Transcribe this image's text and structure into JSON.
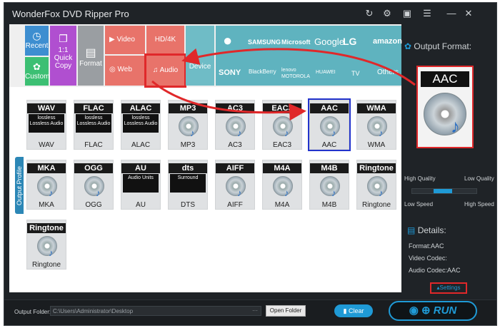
{
  "app": {
    "title": "WonderFox DVD Ripper Pro"
  },
  "titlebar_icons": [
    "refresh-icon",
    "settings-icon",
    "feedback-icon",
    "menu-icon",
    "minimize-icon",
    "close-icon"
  ],
  "categories": {
    "recent": "Recent",
    "custom": "Custom",
    "copy": "1:1 Quick Copy",
    "format": "Format",
    "video": "Video",
    "web": "Web",
    "hd": "HD/4K",
    "audio": "Audio",
    "device": "Device",
    "brands_top": [
      "",
      "SAMSUNG",
      "Microsoft",
      "Google",
      "LG",
      "amazon"
    ],
    "brands_bottom": [
      "SONY",
      "BlackBerry",
      "lenovo MOTOROLA",
      "HUAWEI",
      "TV",
      "Others"
    ],
    "output_profile": "Output Profile"
  },
  "formats": [
    {
      "code": "WAV",
      "name": "WAV",
      "sub": "lossless Lossless Audio"
    },
    {
      "code": "FLAC",
      "name": "FLAC",
      "sub": "lossless Lossless Audio"
    },
    {
      "code": "ALAC",
      "name": "ALAC",
      "sub": "lossless Lossless Audio"
    },
    {
      "code": "MP3",
      "name": "MP3",
      "sub": ""
    },
    {
      "code": "AC3",
      "name": "AC3",
      "sub": ""
    },
    {
      "code": "EAC3",
      "name": "EAC3",
      "sub": ""
    },
    {
      "code": "AAC",
      "name": "AAC",
      "sub": ""
    },
    {
      "code": "WMA",
      "name": "WMA",
      "sub": ""
    },
    {
      "code": "MKA",
      "name": "MKA",
      "sub": ""
    },
    {
      "code": "OGG",
      "name": "OGG",
      "sub": ""
    },
    {
      "code": "AU",
      "name": "AU",
      "sub": "Audio Units"
    },
    {
      "code": "dts",
      "name": "DTS",
      "sub": "Surround"
    },
    {
      "code": "AIFF",
      "name": "AIFF",
      "sub": ""
    },
    {
      "code": "M4A",
      "name": "M4A",
      "sub": ""
    },
    {
      "code": "M4B",
      "name": "M4B",
      "sub": ""
    },
    {
      "code": "Ringtone",
      "name": "Ringtone",
      "sub": ""
    },
    {
      "code": "Ringtone",
      "name": "Ringtone",
      "sub": ""
    }
  ],
  "selected_format": "AAC",
  "right": {
    "output_format_label": "Output Format:",
    "preview_code": "AAC",
    "high_quality": "High Quality",
    "low_quality": "Low Quality",
    "low_speed": "Low Speed",
    "high_speed": "High Speed",
    "details_label": "Details:",
    "detail_format": "Format:AAC",
    "detail_video": "Video Codec:",
    "detail_audio": "Audio Codec:AAC",
    "settings": "Settings"
  },
  "bottom": {
    "output_folder_label": "Output Folder:",
    "output_folder_value": "C:\\Users\\Administrator\\Desktop",
    "browse": "···",
    "open_folder": "Open Folder",
    "clear": "Clear",
    "run": "RUN"
  },
  "colors": {
    "accent": "#1f9ad6",
    "highlight_red": "#e0282a",
    "teal": "#5fb3bf"
  }
}
